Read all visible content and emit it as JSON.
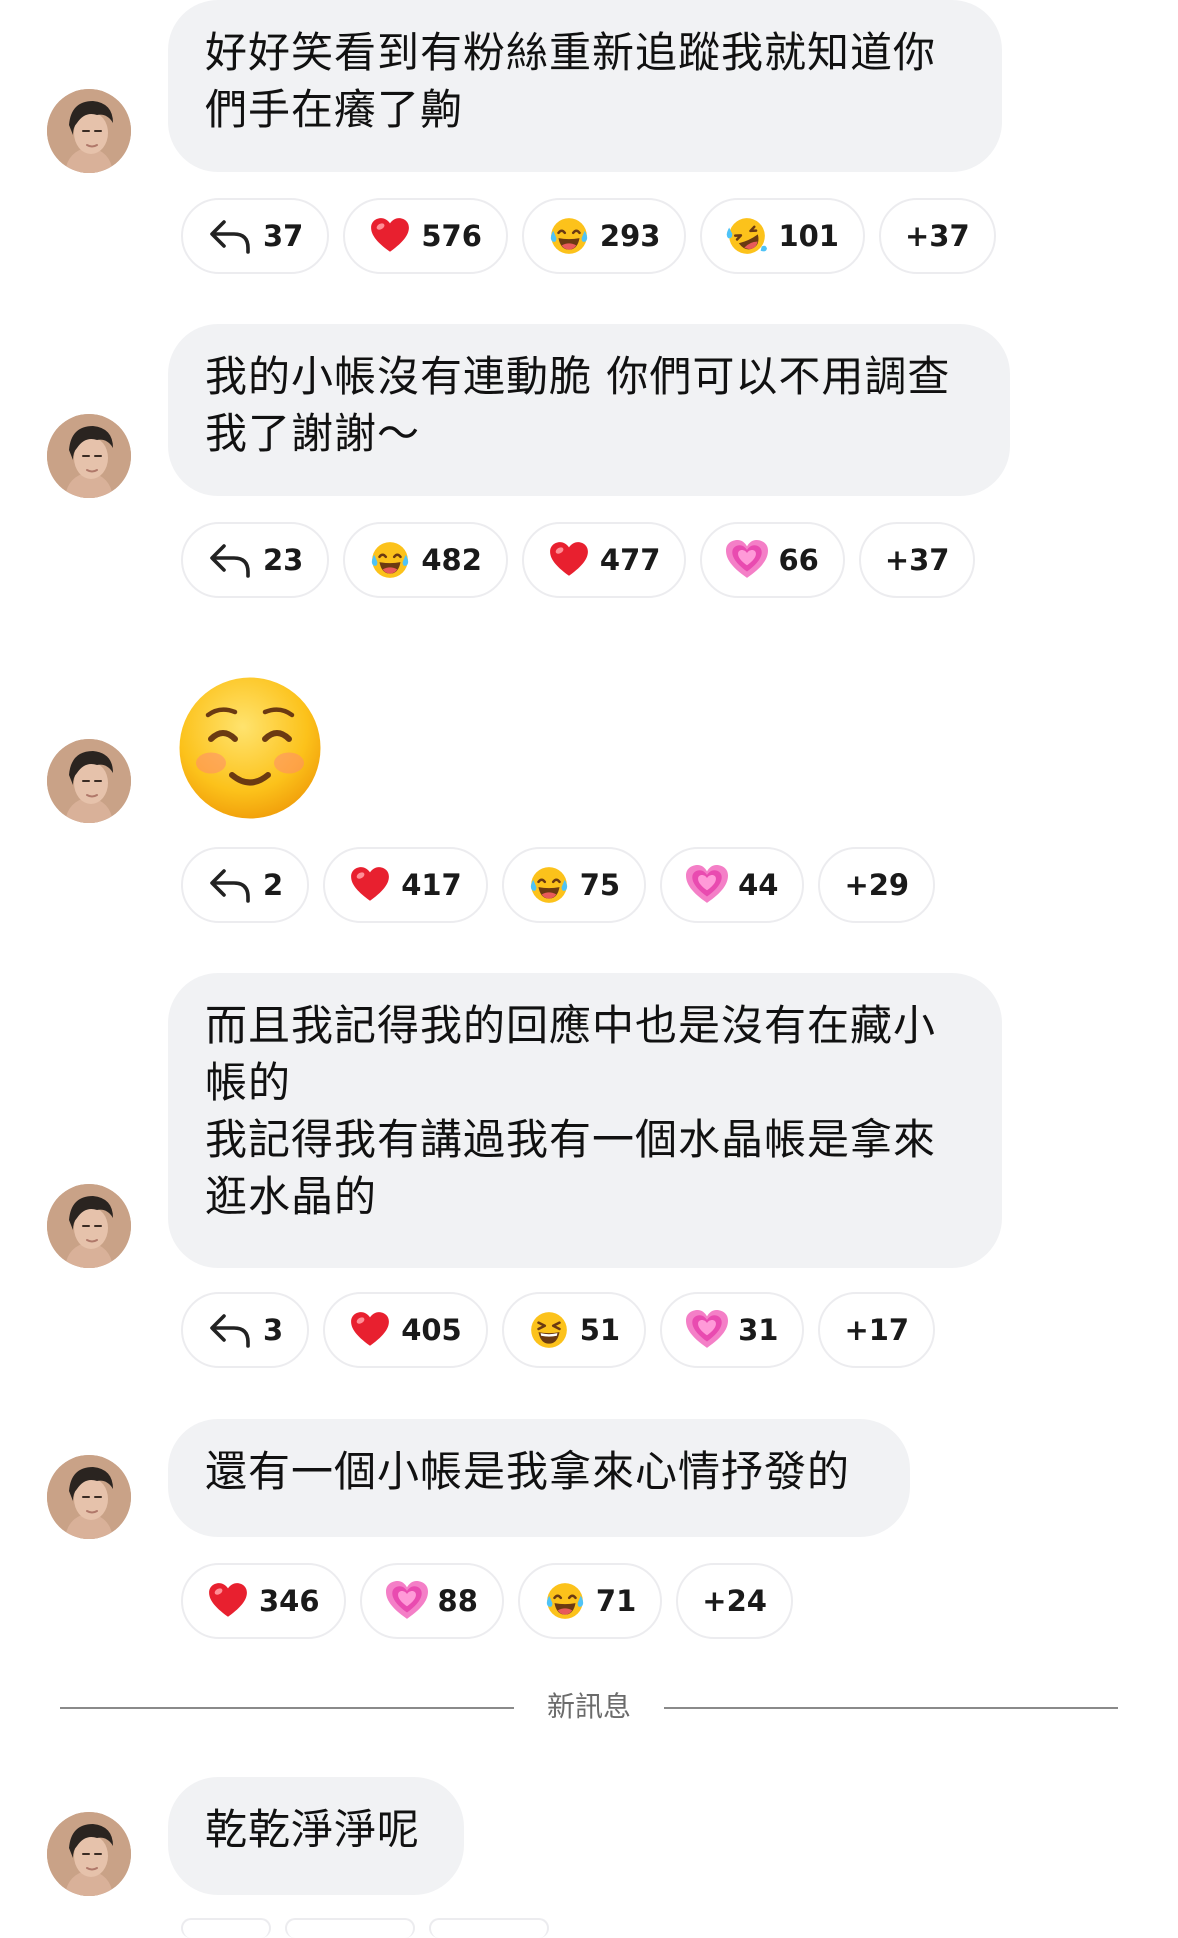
{
  "new_messages_label": "新訊息",
  "messages": [
    {
      "text": "好好笑看到有粉絲重新追蹤我就知道你\n們手在癢了齁",
      "reactions": [
        {
          "icon": "reply-icon",
          "count": "37"
        },
        {
          "icon": "red-heart-icon",
          "count": "576"
        },
        {
          "icon": "tears-of-joy-icon",
          "count": "293"
        },
        {
          "icon": "rolling-laughing-icon",
          "count": "101"
        },
        {
          "icon": "",
          "count": "+37"
        }
      ]
    },
    {
      "text": "我的小帳沒有連動脆 你們可以不用調查\n我了謝謝～",
      "reactions": [
        {
          "icon": "reply-icon",
          "count": "23"
        },
        {
          "icon": "tears-of-joy-icon",
          "count": "482"
        },
        {
          "icon": "red-heart-icon",
          "count": "477"
        },
        {
          "icon": "growing-heart-icon",
          "count": "66"
        },
        {
          "icon": "",
          "count": "+37"
        }
      ]
    },
    {
      "emoji": "smiling-face-icon",
      "reactions": [
        {
          "icon": "reply-icon",
          "count": "2"
        },
        {
          "icon": "red-heart-icon",
          "count": "417"
        },
        {
          "icon": "tears-of-joy-icon",
          "count": "75"
        },
        {
          "icon": "growing-heart-icon",
          "count": "44"
        },
        {
          "icon": "",
          "count": "+29"
        }
      ]
    },
    {
      "text": "而且我記得我的回應中也是沒有在藏小\n帳的\n我記得我有講過我有一個水晶帳是拿來\n逛水晶的",
      "reactions": [
        {
          "icon": "reply-icon",
          "count": "3"
        },
        {
          "icon": "red-heart-icon",
          "count": "405"
        },
        {
          "icon": "grinning-squint-icon",
          "count": "51"
        },
        {
          "icon": "growing-heart-icon",
          "count": "31"
        },
        {
          "icon": "",
          "count": "+17"
        }
      ]
    },
    {
      "text": "還有一個小帳是我拿來心情抒發的",
      "reactions": [
        {
          "icon": "red-heart-icon",
          "count": "346"
        },
        {
          "icon": "growing-heart-icon",
          "count": "88"
        },
        {
          "icon": "tears-of-joy-icon",
          "count": "71"
        },
        {
          "icon": "",
          "count": "+24"
        }
      ]
    },
    {
      "text": "乾乾淨淨呢",
      "reactions": []
    }
  ]
}
